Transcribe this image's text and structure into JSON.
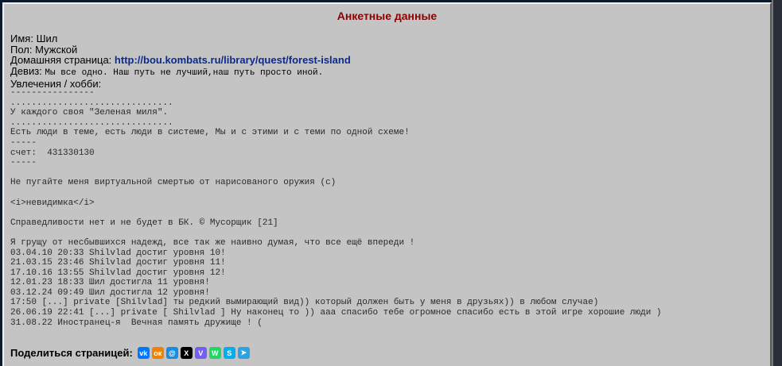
{
  "title": "Анкетные данные",
  "profile": {
    "name_label": "Имя:",
    "name": "Шил",
    "gender_label": "Пол:",
    "gender": "Мужской",
    "homepage_label": "Домашняя страница:",
    "homepage": "http://bou.kombats.ru/library/quest/forest-island",
    "motto_label": "Девиз:",
    "motto": "Мы все одно. Наш путь не лучший,наш путь просто иной.",
    "hobby_label": "Увлечения / хобби:"
  },
  "about_lines": [
    "----------------",
    "...............................",
    "У каждого своя \"Зеленая миля\".",
    "...............................",
    "Есть люди в теме, есть люди в системе, Мы и с этими и с теми по одной схеме!",
    "-----",
    "счет:  431330130",
    "-----",
    "",
    "Не пугайте меня виртуальной смертью от нарисованого оружия (с)",
    "",
    "<i>невидимка</i>",
    "",
    "Справедливости нет и не будет в БК. © Мусорщик [21]",
    "",
    "Я грущу от несбывшихся надежд, все так же наивно думая, что все ещё впереди !",
    "03.04.10 20:33 Shilvlad достиг уровня 10!",
    "21.03.15 23:46 Shilvlad достиг уровня 11!",
    "17.10.16 13:55 Shilvlad достиг уровня 12!",
    "12.01.23 18:33 Шил достигла 11 уровня!",
    "03.12.24 09:49 Шил достигла 12 уровня!",
    "17:50 [...] private [Shilvlad] ты редкий вымирающий вид)) который должен быть у меня в друзьях)) в любом случае)",
    "26.06.19 22:41 [...] private [ Shilvlad ] Ну наконец то )) ааа спасибо тебе огромное спасибо есть в этой игре хорошие люди )",
    "31.08.22 Иностранец-я  Вечная память дружище ! ("
  ],
  "share": {
    "label": "Поделиться страницей:",
    "icons": [
      {
        "name": "vk-icon",
        "glyph": "vk",
        "color": "#0077ff"
      },
      {
        "name": "odnoklassniki-icon",
        "glyph": "ок",
        "color": "#ee8208"
      },
      {
        "name": "moimir-icon",
        "glyph": "@",
        "color": "#168de2"
      },
      {
        "name": "x-twitter-icon",
        "glyph": "X",
        "color": "#000000"
      },
      {
        "name": "viber-icon",
        "glyph": "V",
        "color": "#7360f2"
      },
      {
        "name": "whatsapp-icon",
        "glyph": "W",
        "color": "#25d366"
      },
      {
        "name": "skype-icon",
        "glyph": "S",
        "color": "#00aff0"
      },
      {
        "name": "telegram-icon",
        "glyph": "➤",
        "color": "#2aa3e0"
      }
    ]
  },
  "colors": {
    "title": "#8b0000",
    "link": "#0b2a8a",
    "panel": "#c4c4c4"
  }
}
